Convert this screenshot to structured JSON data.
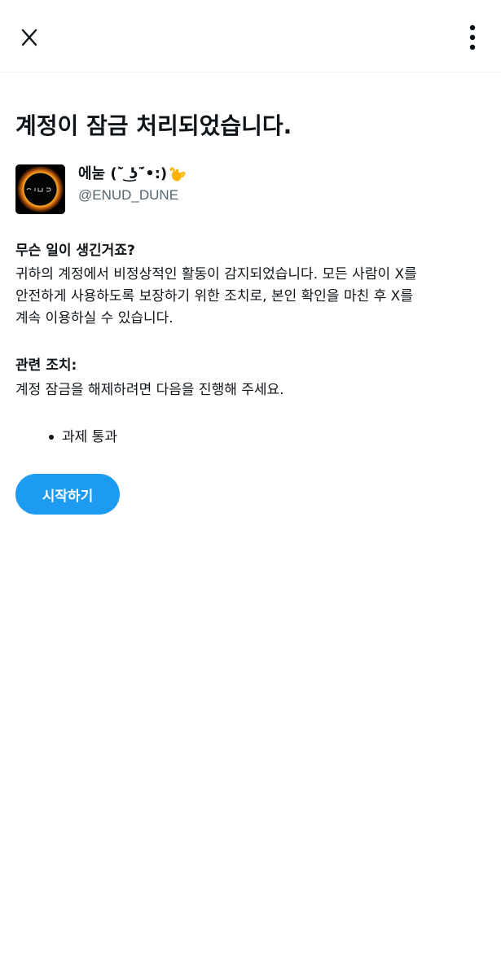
{
  "header": {
    "close_icon": "x-logo-close-icon",
    "more_icon": "vertical-ellipsis-icon"
  },
  "page": {
    "title": "계정이 잠금 처리되었습니다."
  },
  "account": {
    "avatar_icon": "eclipse-ring-avatar",
    "display_name": "에눋 (˜̀ ͜ʖ˜́•:)",
    "emoji_icon": "call-me-hand-emoji-icon",
    "handle": "@ENUD_DUNE"
  },
  "what_happened": {
    "heading": "무슨 일이 생긴거죠?",
    "lines": [
      "귀하의 계정에서 비정상적인 활동이 감지되었습니다. 모든 사람이 X를",
      "안전하게 사용하도록 보장하기 위한 조치로, 본인 확인을 마친 후 X를",
      "계속 이용하실 수 있습니다."
    ]
  },
  "related_action": {
    "heading": "관련 조치:",
    "description": "계정 잠금을 해제하려면 다음을 진행해 주세요.",
    "steps": [
      "과제 통과"
    ]
  },
  "actions": {
    "start_label": "시작하기"
  },
  "colors": {
    "accent": "#1d9bf0",
    "text": "#0f1419",
    "secondary_text": "#536471"
  }
}
